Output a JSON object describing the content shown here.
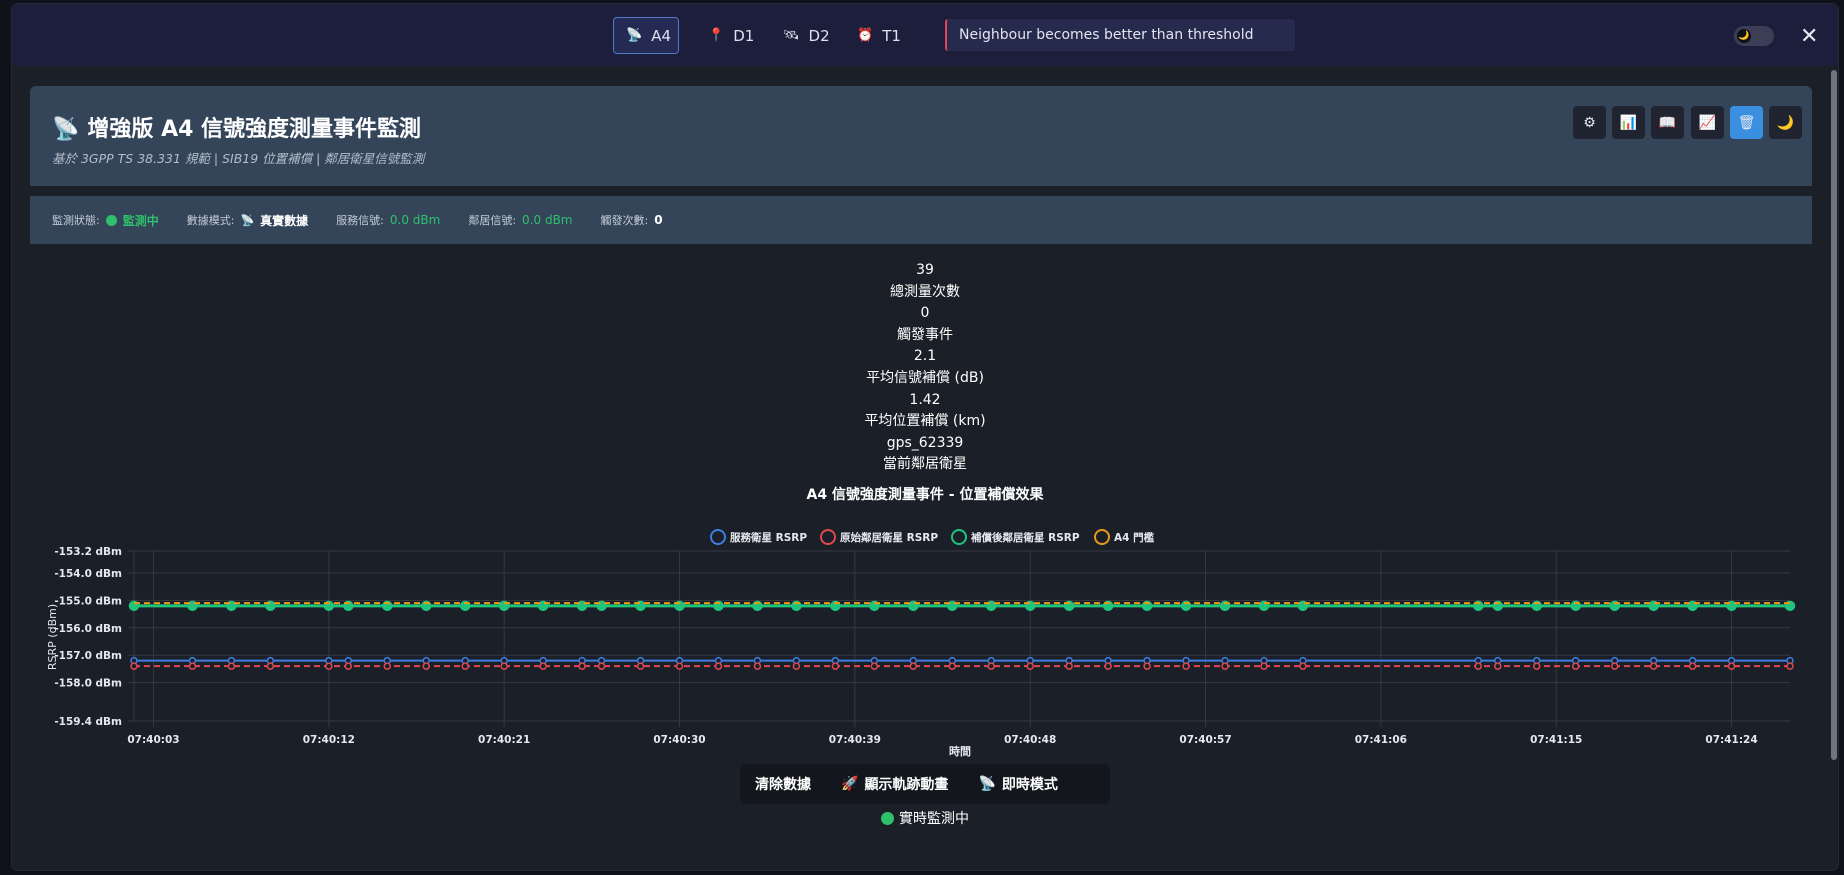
{
  "nav": {
    "tabs": [
      {
        "label": "A4",
        "icon": "satellite-icon",
        "glyph": "📡",
        "active": true
      },
      {
        "label": "D1",
        "icon": "pin-icon",
        "glyph": "📍",
        "active": false
      },
      {
        "label": "D2",
        "icon": "satellite-orbit-icon",
        "glyph": "🛰",
        "active": false
      },
      {
        "label": "T1",
        "icon": "clock-icon",
        "glyph": "⏰",
        "active": false
      }
    ],
    "event_description": "Neighbour becomes better than threshold",
    "theme_toggle_icon": "moon-icon",
    "close_label": "✕"
  },
  "header": {
    "icon": "📡",
    "title": "增強版 A4 信號強度測量事件監測",
    "subtitle": "基於 3GPP TS 38.331 規範 | SIB19 位置補償 | 鄰居衛星信號監測",
    "tools": [
      {
        "name": "settings-icon",
        "glyph": "⚙"
      },
      {
        "name": "bar-chart-icon",
        "glyph": "📊"
      },
      {
        "name": "book-icon",
        "glyph": "📖"
      },
      {
        "name": "line-chart-icon",
        "glyph": "📈"
      },
      {
        "name": "trash-icon",
        "glyph": "🗑",
        "active": true
      },
      {
        "name": "moon-icon",
        "glyph": "🌙"
      }
    ]
  },
  "status": {
    "monitor_label": "監測狀態:",
    "monitor_value": "監測中",
    "mode_label": "數據模式:",
    "mode_value": "真實數據",
    "serving_label": "服務信號:",
    "serving_value": "0.0 dBm",
    "neighbor_label": "鄰居信號:",
    "neighbor_value": "0.0 dBm",
    "trigger_label": "觸發次數:",
    "trigger_value": "0"
  },
  "stats": [
    {
      "value": "39",
      "label": "總測量次數"
    },
    {
      "value": "0",
      "label": "觸發事件"
    },
    {
      "value": "2.1",
      "label": "平均信號補償 (dB)"
    },
    {
      "value": "1.42",
      "label": "平均位置補償 (km)"
    },
    {
      "value": "gps_62339",
      "label": "當前鄰居衛星"
    }
  ],
  "chart_data": {
    "type": "line",
    "title": "A4 信號強度測量事件 - 位置補償效果",
    "xlabel": "時間",
    "ylabel": "RSRP (dBm)",
    "ylim": [
      -159.4,
      -153.2
    ],
    "yticks": [
      "-153.2 dBm",
      "-154.0 dBm",
      "-155.0 dBm",
      "-156.0 dBm",
      "-157.0 dBm",
      "-158.0 dBm",
      "-159.4 dBm"
    ],
    "x_ticks": [
      "07:40:03",
      "07:40:12",
      "07:40:21",
      "07:40:30",
      "07:40:39",
      "07:40:48",
      "07:40:57",
      "07:41:06",
      "07:41:15",
      "07:41:24"
    ],
    "x_range": [
      "07:40:02",
      "07:41:27"
    ],
    "grid": true,
    "legend_position": "top",
    "point_times_sec": [
      2,
      5,
      7,
      9,
      12,
      13,
      15,
      17,
      19,
      21,
      23,
      25,
      26,
      28,
      30,
      32,
      34,
      36,
      38,
      40,
      42,
      44,
      46,
      48,
      50,
      52,
      54,
      56,
      58,
      60,
      62,
      71,
      72,
      74,
      76,
      78,
      80,
      82,
      84,
      87
    ],
    "series": [
      {
        "name": "服務衛星 RSRP",
        "color": "#3f7de0",
        "dashed": false,
        "value": -157.2
      },
      {
        "name": "原始鄰居衛星 RSRP",
        "color": "#e0474f",
        "dashed": true,
        "value": -157.4
      },
      {
        "name": "補償後鄰居衛星 RSRP",
        "color": "#1ec47c",
        "dashed": false,
        "value": -155.2
      },
      {
        "name": "A4 門檻",
        "color": "#e69a18",
        "dashed": true,
        "value": -155.1,
        "no_points": true
      }
    ]
  },
  "controls": {
    "clear_label": "清除數據",
    "trajectory_label": "顯示軌跡動畫",
    "realtime_label": "即時模式"
  },
  "live_status": "實時監測中"
}
